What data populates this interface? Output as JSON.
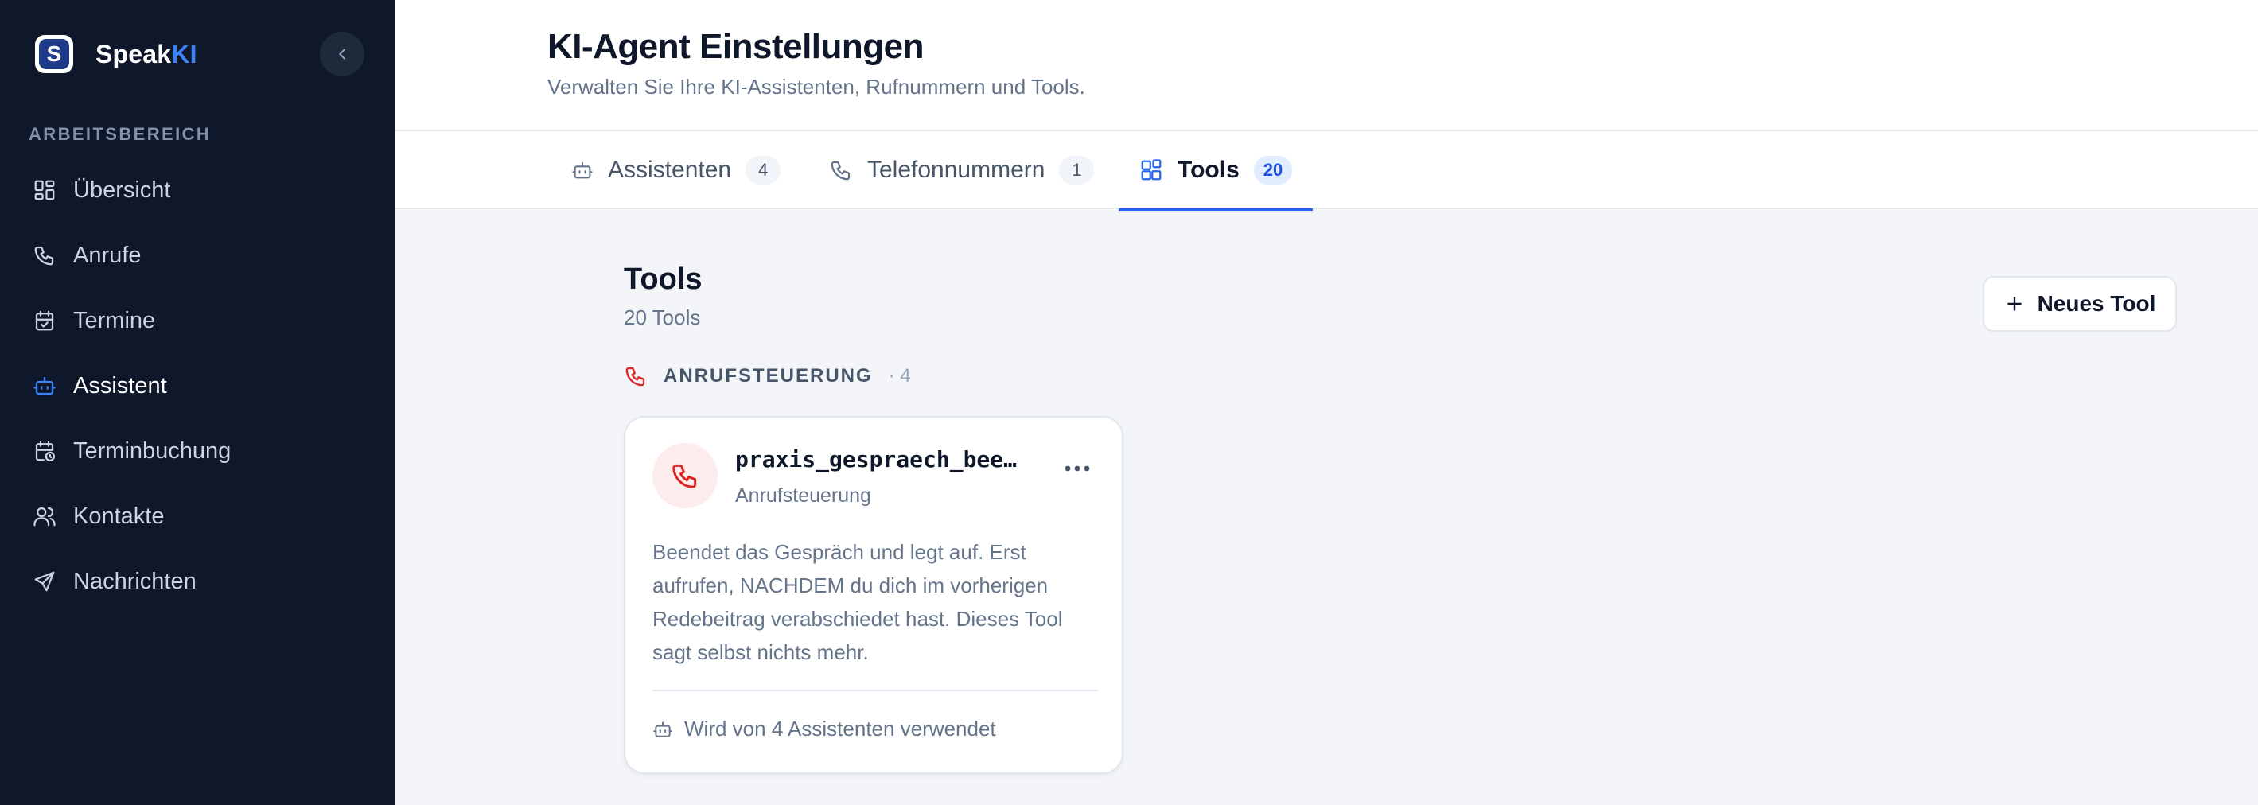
{
  "sidebar": {
    "brand_prefix": "Speak",
    "brand_suffix": "KI",
    "logo_letter": "S",
    "section_label": "ARBEITSBEREICH",
    "items": [
      {
        "label": "Übersicht",
        "icon": "grid-icon"
      },
      {
        "label": "Anrufe",
        "icon": "phone-icon"
      },
      {
        "label": "Termine",
        "icon": "calendar-check-icon"
      },
      {
        "label": "Assistent",
        "icon": "bot-icon",
        "active": true
      },
      {
        "label": "Terminbuchung",
        "icon": "calendar-clock-icon"
      },
      {
        "label": "Kontakte",
        "icon": "users-icon"
      },
      {
        "label": "Nachrichten",
        "icon": "send-icon"
      }
    ]
  },
  "header": {
    "title": "KI-Agent Einstellungen",
    "subtitle": "Verwalten Sie Ihre KI-Assistenten, Rufnummern und Tools."
  },
  "tabs": [
    {
      "label": "Assistenten",
      "count": "4",
      "icon": "bot-icon"
    },
    {
      "label": "Telefonnummern",
      "count": "1",
      "icon": "phone-icon"
    },
    {
      "label": "Tools",
      "count": "20",
      "icon": "blocks-icon",
      "active": true
    }
  ],
  "main": {
    "title": "Tools",
    "count_label": "20 Tools",
    "new_button_label": "Neues Tool",
    "category": {
      "label": "ANRUFSTEUERUNG",
      "count": "· 4",
      "icon": "phone-icon"
    },
    "cards": [
      {
        "name": "praxis_gespraech_beenden",
        "type": "Anrufsteuerung",
        "description": "Beendet das Gespräch und legt auf. Erst aufrufen, NACHDEM du dich im vorherigen Redebeitrag verabschiedet hast. Dieses Tool sagt selbst nichts mehr.",
        "usage": "Wird von 4 Assistenten verwendet"
      }
    ]
  },
  "colors": {
    "sidebar_bg": "#0f172a",
    "accent": "#2563eb",
    "danger": "#dc2626"
  }
}
